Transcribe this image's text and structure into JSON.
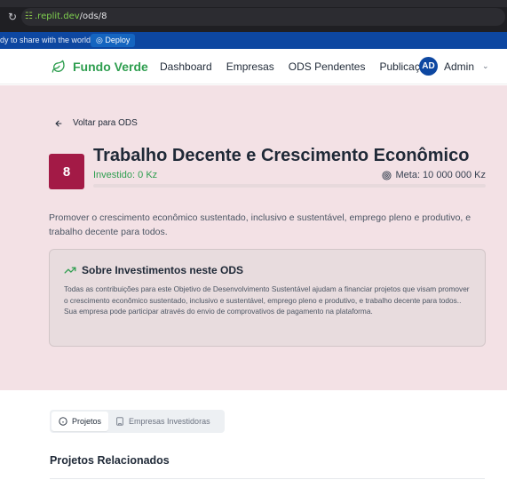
{
  "browser": {
    "url_host": ".replit.dev",
    "url_path": "/ods/8"
  },
  "replit_bar": {
    "message": "dy to share with the world?",
    "deploy_label": "Deploy"
  },
  "nav": {
    "brand": "Fundo Verde",
    "links": [
      "Dashboard",
      "Empresas",
      "ODS Pendentes",
      "Publicações"
    ],
    "user_initials": "AD",
    "user_name": "Admin"
  },
  "page": {
    "back_label": "Voltar para ODS",
    "ods_number": "8",
    "title": "Trabalho Decente e Crescimento Econômico",
    "invested": "Investido: 0 Kz",
    "goal": "Meta: 10 000 000 Kz",
    "progress_fraction": 0,
    "description": "Promover o crescimento econômico sustentado, inclusivo e sustentável, emprego pleno e produtivo, e trabalho decente para todos.",
    "info": {
      "title": "Sobre Investimentos neste ODS",
      "body": "Todas as contribuições para este Objetivo de Desenvolvimento Sustentável ajudam a financiar projetos que visam promover o crescimento econômico sustentado, inclusivo e sustentável, emprego pleno e produtivo, e trabalho decente para todos.. Sua empresa pode participar através do envio de comprovativos de pagamento na plataforma."
    },
    "tabs": [
      {
        "label": "Projetos",
        "icon": "info-icon",
        "active": true
      },
      {
        "label": "Empresas Investidoras",
        "icon": "building-icon",
        "active": false
      }
    ],
    "section_title": "Projetos Relacionados"
  },
  "colors": {
    "brand_green": "#2e9e4f",
    "ods_badge": "#a31a46",
    "hero_bg": "#f3e1e5",
    "avatar": "#0d47a1"
  }
}
